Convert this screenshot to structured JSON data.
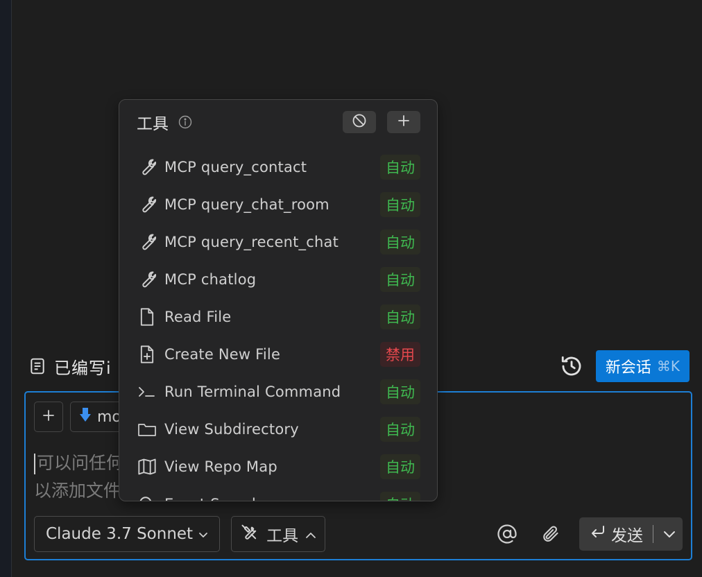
{
  "header": {
    "title": "已编写i",
    "new_chat_label": "新会话",
    "new_chat_shortcut": "⌘K"
  },
  "composer": {
    "context_chip_label": "mo",
    "placeholder_line1": "可以问任何问题，@ 添加上下文，按住 ⇧ 并拖动",
    "placeholder_line2": "以添加文件",
    "model_label": "Claude 3.7 Sonnet",
    "tools_label": "工具",
    "send_label": "发送"
  },
  "popover": {
    "title": "工具",
    "tools": [
      {
        "name": "MCP query_contact",
        "status": "自动",
        "icon": "wrench-icon"
      },
      {
        "name": "MCP query_chat_room",
        "status": "自动",
        "icon": "wrench-icon"
      },
      {
        "name": "MCP query_recent_chat",
        "status": "自动",
        "icon": "wrench-icon"
      },
      {
        "name": "MCP chatlog",
        "status": "自动",
        "icon": "wrench-icon"
      },
      {
        "name": "Read File",
        "status": "自动",
        "icon": "file-icon"
      },
      {
        "name": "Create New File",
        "status": "禁用",
        "icon": "file-plus-icon"
      },
      {
        "name": "Run Terminal Command",
        "status": "自动",
        "icon": "terminal-icon"
      },
      {
        "name": "View Subdirectory",
        "status": "自动",
        "icon": "folder-icon"
      },
      {
        "name": "View Repo Map",
        "status": "自动",
        "icon": "map-icon"
      },
      {
        "name": "Exact Search",
        "status": "自动",
        "icon": "search-icon"
      }
    ]
  },
  "colors": {
    "accent": "#0a78d6",
    "auto_status": "#3fb950",
    "disabled_status": "#e5484d"
  }
}
